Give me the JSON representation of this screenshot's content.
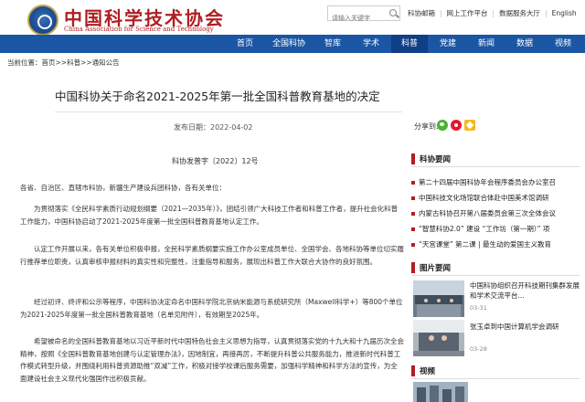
{
  "header": {
    "brand_cn": "中国科学技术协会",
    "brand_en": "China Association for Science and Technology",
    "search_placeholder": "请输入关键字",
    "links": [
      "科协邮箱",
      "网上工作平台",
      "数据服务大厅",
      "English"
    ]
  },
  "nav": {
    "items": [
      "首页",
      "全国科协",
      "智库",
      "学术",
      "科普",
      "党建",
      "新闻",
      "数据",
      "视频"
    ],
    "active_index": 4
  },
  "breadcrumb": {
    "prefix": "当前位置：",
    "path": "首页>>科普>>通知公告"
  },
  "article": {
    "title": "中国科协关于命名2021-2025年第一批全国科普教育基地的决定",
    "date": "发布日期：2022-04-02",
    "share_label": "分享到:",
    "doc_no": "科协发普字〔2022〕12号",
    "paragraphs": [
      "各省、自治区、直辖市科协，新疆生产建设兵团科协，各有关单位：",
      "为贯彻落实《全民科学素质行动规划纲要（2021—2035年）》，团结引领广大科技工作者和科普工作者，提升社会化科普工作能力，中国科协启动了2021-2025年度第一批全国科普教育基地认定工作。",
      "认定工作开展以来，各有关单位积极申报，全民科学素质纲要实施工作办公室成员单位、全国学会、各地科协等单位切实履行推荐单位职责，认真审核申报材料的真实性和完整性，注重指导和服务，展现出科普工作大联合大协作的良好氛围。",
      "经过初评、终评和公示等程序，中国科协决定命名中国科学院北京纳米能源与系统研究所（Maxwell科学+）等800个单位为2021-2025年度第一批全国科普教育基地（名单见附件），有效期至2025年。",
      "希望被命名的全国科普教育基地以习近平新时代中国特色社会主义思想为指导，认真贯彻落实党的十九大和十九届历次全会精神，按照《全国科普教育基地创建与认定管理办法》，因地制宜，再接再厉，不断提升科普公共服务能力，推进新时代科普工作模式转型升级，并围绕利用科普资源助推“双减”工作，积极对接学校课后服务需要，加强科学精神和科学方法的宣传，为全面建设社会主义现代化强国作出积极贡献。"
    ]
  },
  "sidebar": {
    "news_title": "科协要闻",
    "news": [
      "第二十四届中国科协年会程序委员会办公室召",
      "中国科技文化场馆联合体赴中国美术馆调研",
      "内蒙古科协召开第八届委员会第三次全体会议",
      "“智慧科协2.0” 建设 “工作坊（第一期）” 项",
      "“天宫课堂” 第二课 | 最生动的爱国主义教育"
    ],
    "pictures_title": "图片要闻",
    "pictures": [
      {
        "title": "中国科协组织召开科技期刊集群发展和学术交流平台...",
        "date": "03-31"
      },
      {
        "title": "张玉卓到中国计算机学会调研",
        "date": "03-28"
      }
    ],
    "video_title": "视频"
  },
  "colors": {
    "nav_blue": "#1a56a4",
    "nav_active": "#0f3f86",
    "brand_red": "#b01e23"
  }
}
